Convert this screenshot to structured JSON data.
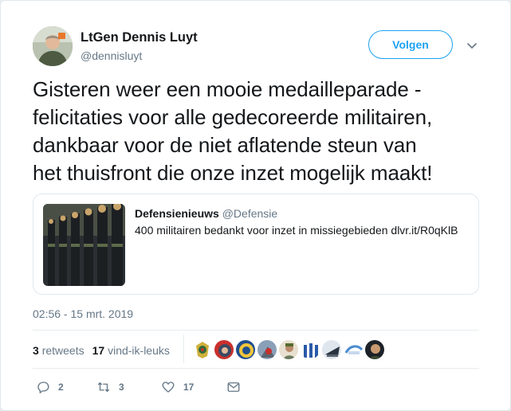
{
  "author": {
    "name": "LtGen Dennis Luyt",
    "handle": "@dennisluyt"
  },
  "follow_label": "Volgen",
  "tweet_lines": [
    "Gisteren weer een mooie medailleparade -",
    "felicitaties voor alle gedecoreerde militairen,",
    "dankbaar voor de niet aflatende steun van",
    "het thuisfront die onze inzet mogelijk maakt!"
  ],
  "quote": {
    "name": "Defensienieuws",
    "handle": "@Defensie",
    "text": "400 militairen bedankt voor inzet in missiegebieden dlvr.it/R0qKlB"
  },
  "timestamp": "02:56 - 15 mrt. 2019",
  "stats": {
    "retweets_count": "3",
    "retweets_label": "retweets",
    "likes_count": "17",
    "likes_label": "vind-ik-leuks"
  },
  "actions": {
    "replies": "2",
    "retweets": "3",
    "likes": "17"
  },
  "colors": {
    "accent": "#1da1f2",
    "muted": "#657786",
    "text": "#14171a",
    "border": "#e1e8ed"
  }
}
